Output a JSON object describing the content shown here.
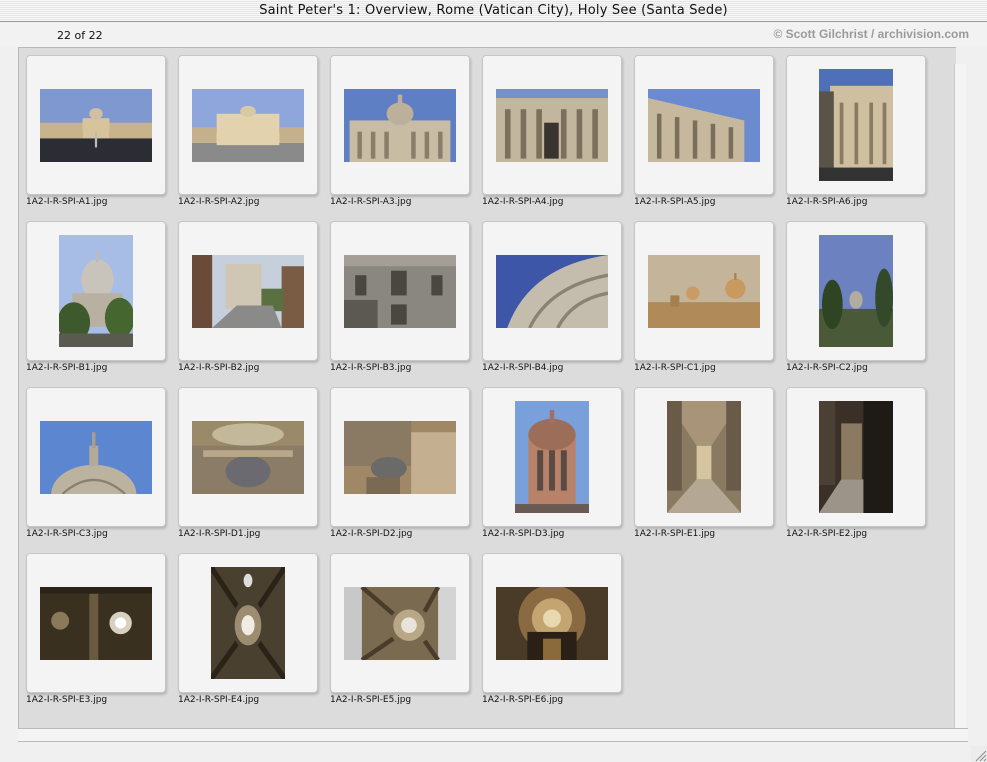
{
  "window": {
    "title": "Saint Peter's 1: Overview, Rome (Vatican City), Holy See (Santa Sede)"
  },
  "header": {
    "counter": "22 of 22",
    "copyright": "© Scott Gilchrist / archivision.com"
  },
  "slides": [
    {
      "filename": "1A2-I-R-SPI-A1.jpg",
      "orientation": "landscape",
      "scene": "piazza-wide",
      "sky": "#7f98d0"
    },
    {
      "filename": "1A2-I-R-SPI-A2.jpg",
      "orientation": "landscape",
      "scene": "facade-far",
      "sky": "#8ea6dc"
    },
    {
      "filename": "1A2-I-R-SPI-A3.jpg",
      "orientation": "landscape",
      "scene": "facade-dome",
      "sky": "#5f7fc4"
    },
    {
      "filename": "1A2-I-R-SPI-A4.jpg",
      "orientation": "landscape",
      "scene": "facade-close",
      "sky": "#7890c8"
    },
    {
      "filename": "1A2-I-R-SPI-A5.jpg",
      "orientation": "landscape",
      "scene": "facade-oblique",
      "sky": "#6b8ad0"
    },
    {
      "filename": "1A2-I-R-SPI-A6.jpg",
      "orientation": "portrait",
      "scene": "facade-portrait",
      "sky": "#4f6fb8"
    },
    {
      "filename": "1A2-I-R-SPI-B1.jpg",
      "orientation": "portrait",
      "scene": "dome-trees",
      "sky": "#a8bde6"
    },
    {
      "filename": "1A2-I-R-SPI-B2.jpg",
      "orientation": "landscape",
      "scene": "street",
      "sky": "#c6d0dc"
    },
    {
      "filename": "1A2-I-R-SPI-B3.jpg",
      "orientation": "landscape",
      "scene": "wall-dark",
      "sky": "#6a6a70"
    },
    {
      "filename": "1A2-I-R-SPI-B4.jpg",
      "orientation": "landscape",
      "scene": "dome-side",
      "sky": "#3e56a8"
    },
    {
      "filename": "1A2-I-R-SPI-C1.jpg",
      "orientation": "landscape",
      "scene": "skyline-warm",
      "sky": "#c4b49a"
    },
    {
      "filename": "1A2-I-R-SPI-C2.jpg",
      "orientation": "portrait",
      "scene": "dome-distant",
      "sky": "#6c82c0"
    },
    {
      "filename": "1A2-I-R-SPI-C3.jpg",
      "orientation": "landscape",
      "scene": "dome-top",
      "sky": "#5d86d0"
    },
    {
      "filename": "1A2-I-R-SPI-D1.jpg",
      "orientation": "landscape",
      "scene": "aerial-piazza",
      "sky": "#9a8a6a"
    },
    {
      "filename": "1A2-I-R-SPI-D2.jpg",
      "orientation": "landscape",
      "scene": "aerial-roofs",
      "sky": "#a08866"
    },
    {
      "filename": "1A2-I-R-SPI-D3.jpg",
      "orientation": "portrait",
      "scene": "cupola",
      "sky": "#7aa0dc"
    },
    {
      "filename": "1A2-I-R-SPI-E1.jpg",
      "orientation": "portrait",
      "scene": "nave",
      "sky": "#8a7a62"
    },
    {
      "filename": "1A2-I-R-SPI-E2.jpg",
      "orientation": "portrait",
      "scene": "aisle-dark",
      "sky": "#3a3028"
    },
    {
      "filename": "1A2-I-R-SPI-E3.jpg",
      "orientation": "landscape",
      "scene": "ceiling-dark",
      "sky": "#3a3020"
    },
    {
      "filename": "1A2-I-R-SPI-E4.jpg",
      "orientation": "portrait",
      "scene": "ceiling-portrait",
      "sky": "#4a4030"
    },
    {
      "filename": "1A2-I-R-SPI-E5.jpg",
      "orientation": "landscape",
      "scene": "ceiling-bright",
      "sky": "#7a6a50"
    },
    {
      "filename": "1A2-I-R-SPI-E6.jpg",
      "orientation": "landscape",
      "scene": "dome-interior",
      "sky": "#8a6a40"
    }
  ],
  "colors": {
    "panel": "#dcdcdc",
    "slide": "#f4f4f4",
    "copyright": "#9a9a9a"
  }
}
